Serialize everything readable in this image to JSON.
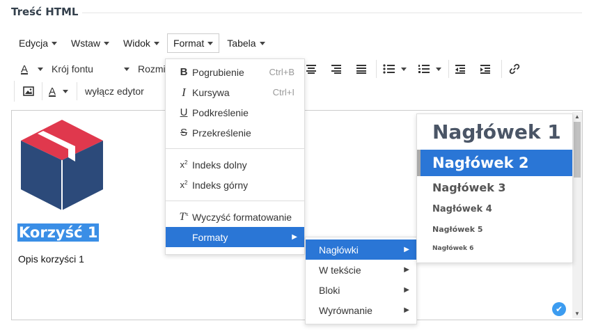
{
  "section_title": "Treść HTML",
  "menubar": [
    {
      "label": "Edycja"
    },
    {
      "label": "Wstaw"
    },
    {
      "label": "Widok"
    },
    {
      "label": "Format"
    },
    {
      "label": "Tabela"
    }
  ],
  "toolbar": {
    "font_family": "Krój fontu",
    "font_size": "Rozmi",
    "disable_editor": "wyłącz edytor"
  },
  "format_menu": {
    "items": [
      {
        "icon": "bold-icon",
        "glyph": "B",
        "label": "Pogrubienie",
        "shortcut": "Ctrl+B"
      },
      {
        "icon": "italic-icon",
        "glyph": "I",
        "label": "Kursywa",
        "shortcut": "Ctrl+I"
      },
      {
        "icon": "underline-icon",
        "glyph": "U",
        "label": "Podkreślenie",
        "shortcut": ""
      },
      {
        "icon": "strikethrough-icon",
        "glyph": "S",
        "label": "Przekreślenie",
        "shortcut": ""
      },
      {
        "icon": "subscript-icon",
        "glyph": "x₂",
        "label": "Indeks dolny",
        "shortcut": ""
      },
      {
        "icon": "superscript-icon",
        "glyph": "x²",
        "label": "Indeks górny",
        "shortcut": ""
      },
      {
        "icon": "clear-format-icon",
        "glyph": "Tx",
        "label": "Wyczyść formatowanie",
        "shortcut": ""
      },
      {
        "icon": "",
        "glyph": "",
        "label": "Formaty",
        "shortcut": ""
      }
    ]
  },
  "formats_submenu": [
    "Nagłówki",
    "W tekście",
    "Bloki",
    "Wyrównanie"
  ],
  "headings_submenu": [
    "Nagłówek 1",
    "Nagłówek 2",
    "Nagłówek 3",
    "Nagłówek 4",
    "Nagłówek 5",
    "Nagłówek 6"
  ],
  "editor": {
    "heading": "Korzyść 1",
    "description": "Opis korzyści 1"
  },
  "colors": {
    "accent": "#2a76d6",
    "logo_red": "#e0384d",
    "logo_navy": "#2c4a7a"
  }
}
